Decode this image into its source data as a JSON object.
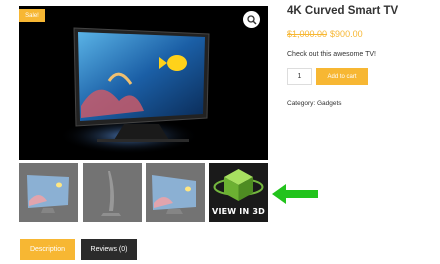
{
  "product": {
    "title": "4K Curved Smart TV",
    "price_old": "$1,000.00",
    "price_new": "$900.00",
    "description": "Check out this awesome TV!",
    "category": "Category: Gadgets",
    "sale_badge": "Sale!"
  },
  "cart": {
    "quantity": "1",
    "add_to_cart_label": "Add to cart"
  },
  "gallery": {
    "view3d_label": "VIEW IN 3D",
    "zoom_icon": "magnifier-icon"
  },
  "tabs": [
    {
      "label": "Description",
      "active": true
    },
    {
      "label": "Reviews (0)",
      "active": false
    }
  ],
  "colors": {
    "accent": "#f7b733",
    "dark_tab": "#2b2b2b",
    "arrow": "#22c31c"
  }
}
